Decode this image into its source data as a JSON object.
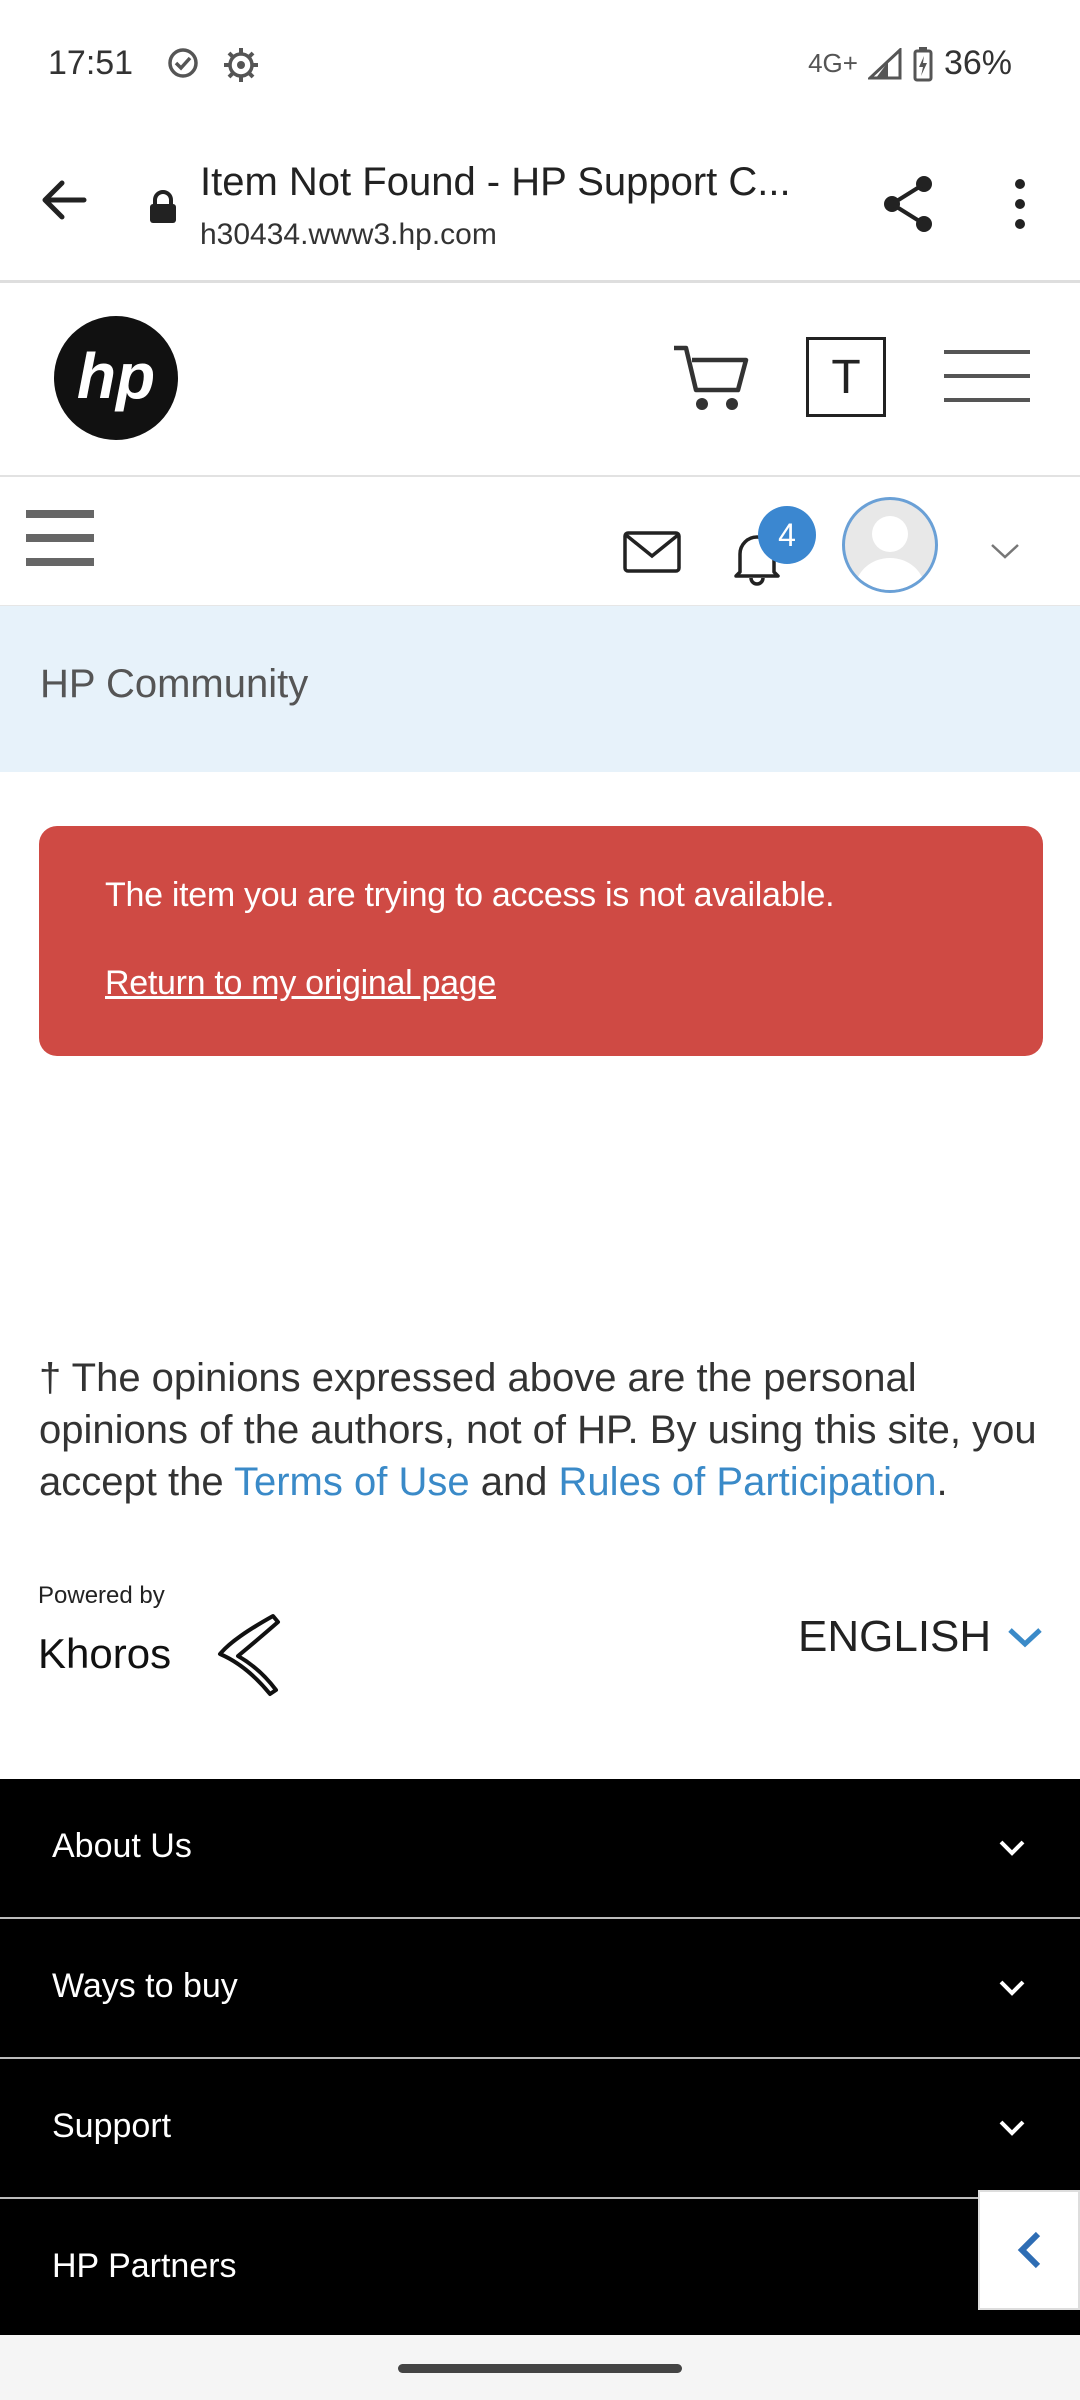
{
  "status_bar": {
    "time": "17:51",
    "network": "4G+",
    "battery": "36%"
  },
  "browser": {
    "page_title": "Item Not Found - HP Support C...",
    "url": "h30434.www3.hp.com"
  },
  "hp_header": {
    "logo_text": "hp",
    "tab_letter": "T"
  },
  "community_toolbar": {
    "notification_count": "4"
  },
  "banner": {
    "title": "HP Community"
  },
  "alert": {
    "message": "The item you are trying to access is not available.",
    "link": "Return to my original page"
  },
  "disclaimer": {
    "part1": "† The opinions expressed above are the personal opinions of the authors, not of HP. By using this site, you accept the ",
    "terms_link": "Terms of Use",
    "part2": " and ",
    "rules_link": "Rules of Participation",
    "part3": "."
  },
  "powered": {
    "label": "Powered by",
    "brand": "Khoros"
  },
  "language": {
    "selected": "ENGLISH"
  },
  "footer": {
    "items": [
      {
        "label": "About Us"
      },
      {
        "label": "Ways to buy"
      },
      {
        "label": "Support"
      },
      {
        "label": "HP Partners"
      }
    ]
  },
  "colors": {
    "alert_bg": "#cf4a44",
    "banner_bg": "#e7f2fa",
    "link": "#3a8ac8",
    "badge": "#3b87d0",
    "footer_bg": "#000000"
  }
}
